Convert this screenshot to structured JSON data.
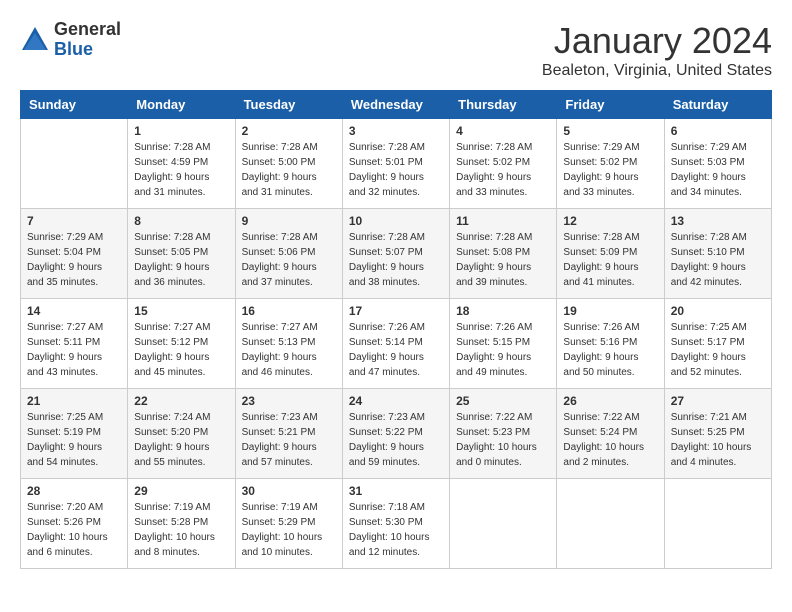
{
  "logo": {
    "general": "General",
    "blue": "Blue"
  },
  "header": {
    "title": "January 2024",
    "location": "Bealeton, Virginia, United States"
  },
  "days_of_week": [
    "Sunday",
    "Monday",
    "Tuesday",
    "Wednesday",
    "Thursday",
    "Friday",
    "Saturday"
  ],
  "weeks": [
    [
      {
        "day": "",
        "info": ""
      },
      {
        "day": "1",
        "info": "Sunrise: 7:28 AM\nSunset: 4:59 PM\nDaylight: 9 hours\nand 31 minutes."
      },
      {
        "day": "2",
        "info": "Sunrise: 7:28 AM\nSunset: 5:00 PM\nDaylight: 9 hours\nand 31 minutes."
      },
      {
        "day": "3",
        "info": "Sunrise: 7:28 AM\nSunset: 5:01 PM\nDaylight: 9 hours\nand 32 minutes."
      },
      {
        "day": "4",
        "info": "Sunrise: 7:28 AM\nSunset: 5:02 PM\nDaylight: 9 hours\nand 33 minutes."
      },
      {
        "day": "5",
        "info": "Sunrise: 7:29 AM\nSunset: 5:02 PM\nDaylight: 9 hours\nand 33 minutes."
      },
      {
        "day": "6",
        "info": "Sunrise: 7:29 AM\nSunset: 5:03 PM\nDaylight: 9 hours\nand 34 minutes."
      }
    ],
    [
      {
        "day": "7",
        "info": "Sunrise: 7:29 AM\nSunset: 5:04 PM\nDaylight: 9 hours\nand 35 minutes."
      },
      {
        "day": "8",
        "info": "Sunrise: 7:28 AM\nSunset: 5:05 PM\nDaylight: 9 hours\nand 36 minutes."
      },
      {
        "day": "9",
        "info": "Sunrise: 7:28 AM\nSunset: 5:06 PM\nDaylight: 9 hours\nand 37 minutes."
      },
      {
        "day": "10",
        "info": "Sunrise: 7:28 AM\nSunset: 5:07 PM\nDaylight: 9 hours\nand 38 minutes."
      },
      {
        "day": "11",
        "info": "Sunrise: 7:28 AM\nSunset: 5:08 PM\nDaylight: 9 hours\nand 39 minutes."
      },
      {
        "day": "12",
        "info": "Sunrise: 7:28 AM\nSunset: 5:09 PM\nDaylight: 9 hours\nand 41 minutes."
      },
      {
        "day": "13",
        "info": "Sunrise: 7:28 AM\nSunset: 5:10 PM\nDaylight: 9 hours\nand 42 minutes."
      }
    ],
    [
      {
        "day": "14",
        "info": "Sunrise: 7:27 AM\nSunset: 5:11 PM\nDaylight: 9 hours\nand 43 minutes."
      },
      {
        "day": "15",
        "info": "Sunrise: 7:27 AM\nSunset: 5:12 PM\nDaylight: 9 hours\nand 45 minutes."
      },
      {
        "day": "16",
        "info": "Sunrise: 7:27 AM\nSunset: 5:13 PM\nDaylight: 9 hours\nand 46 minutes."
      },
      {
        "day": "17",
        "info": "Sunrise: 7:26 AM\nSunset: 5:14 PM\nDaylight: 9 hours\nand 47 minutes."
      },
      {
        "day": "18",
        "info": "Sunrise: 7:26 AM\nSunset: 5:15 PM\nDaylight: 9 hours\nand 49 minutes."
      },
      {
        "day": "19",
        "info": "Sunrise: 7:26 AM\nSunset: 5:16 PM\nDaylight: 9 hours\nand 50 minutes."
      },
      {
        "day": "20",
        "info": "Sunrise: 7:25 AM\nSunset: 5:17 PM\nDaylight: 9 hours\nand 52 minutes."
      }
    ],
    [
      {
        "day": "21",
        "info": "Sunrise: 7:25 AM\nSunset: 5:19 PM\nDaylight: 9 hours\nand 54 minutes."
      },
      {
        "day": "22",
        "info": "Sunrise: 7:24 AM\nSunset: 5:20 PM\nDaylight: 9 hours\nand 55 minutes."
      },
      {
        "day": "23",
        "info": "Sunrise: 7:23 AM\nSunset: 5:21 PM\nDaylight: 9 hours\nand 57 minutes."
      },
      {
        "day": "24",
        "info": "Sunrise: 7:23 AM\nSunset: 5:22 PM\nDaylight: 9 hours\nand 59 minutes."
      },
      {
        "day": "25",
        "info": "Sunrise: 7:22 AM\nSunset: 5:23 PM\nDaylight: 10 hours\nand 0 minutes."
      },
      {
        "day": "26",
        "info": "Sunrise: 7:22 AM\nSunset: 5:24 PM\nDaylight: 10 hours\nand 2 minutes."
      },
      {
        "day": "27",
        "info": "Sunrise: 7:21 AM\nSunset: 5:25 PM\nDaylight: 10 hours\nand 4 minutes."
      }
    ],
    [
      {
        "day": "28",
        "info": "Sunrise: 7:20 AM\nSunset: 5:26 PM\nDaylight: 10 hours\nand 6 minutes."
      },
      {
        "day": "29",
        "info": "Sunrise: 7:19 AM\nSunset: 5:28 PM\nDaylight: 10 hours\nand 8 minutes."
      },
      {
        "day": "30",
        "info": "Sunrise: 7:19 AM\nSunset: 5:29 PM\nDaylight: 10 hours\nand 10 minutes."
      },
      {
        "day": "31",
        "info": "Sunrise: 7:18 AM\nSunset: 5:30 PM\nDaylight: 10 hours\nand 12 minutes."
      },
      {
        "day": "",
        "info": ""
      },
      {
        "day": "",
        "info": ""
      },
      {
        "day": "",
        "info": ""
      }
    ]
  ]
}
